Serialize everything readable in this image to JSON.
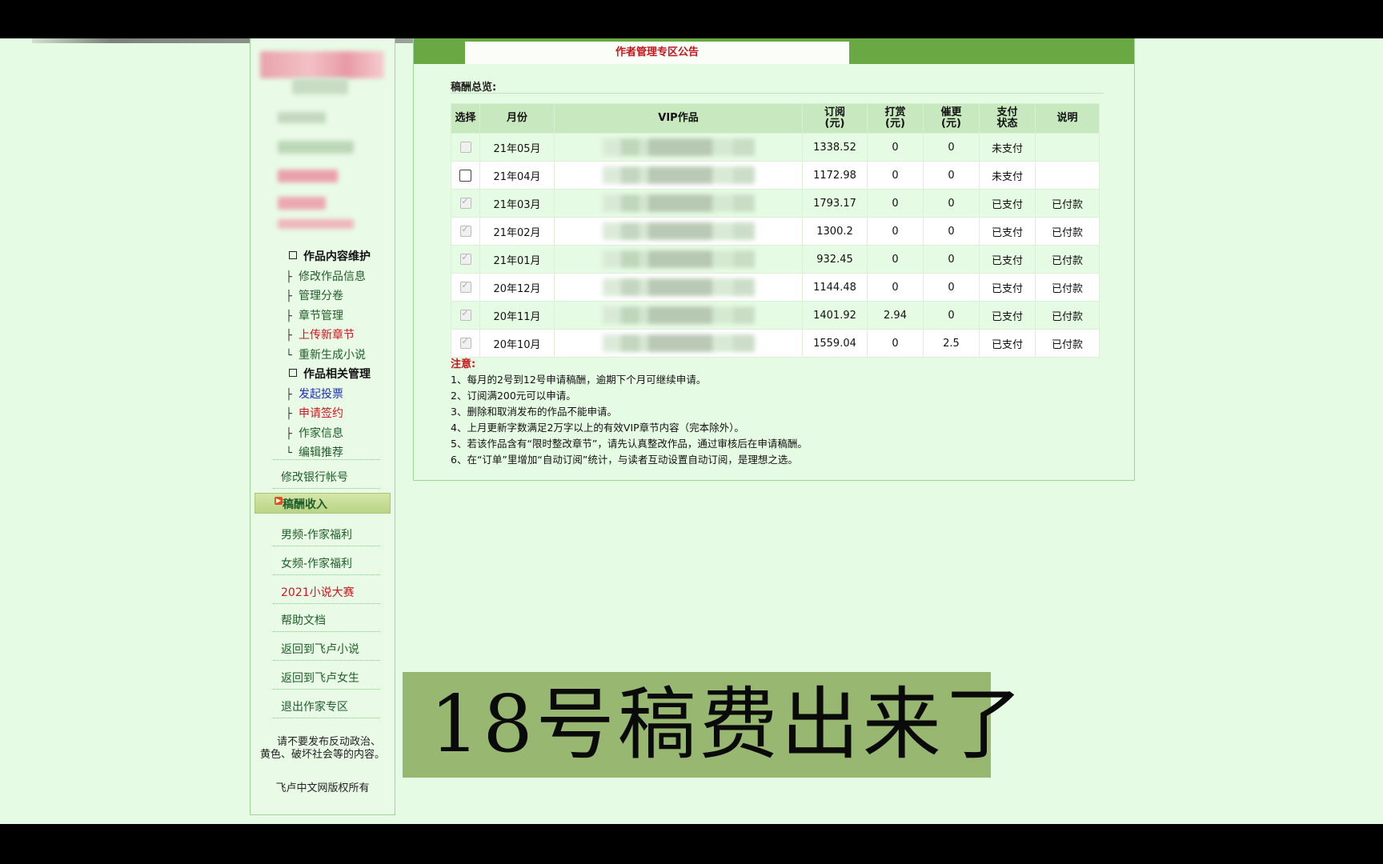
{
  "announcement": {
    "title": "作者管理专区公告"
  },
  "sidebar": {
    "tree": [
      {
        "type": "head",
        "label": "作品内容维护"
      },
      {
        "type": "item",
        "prefix": "├",
        "label": "修改作品信息",
        "color": "#1f5d2a"
      },
      {
        "type": "item",
        "prefix": "├",
        "label": "管理分卷",
        "color": "#1f5d2a"
      },
      {
        "type": "item",
        "prefix": "├",
        "label": "章节管理",
        "color": "#1f5d2a"
      },
      {
        "type": "item",
        "prefix": "├",
        "label": "上传新章节",
        "color": "#d2141f"
      },
      {
        "type": "item",
        "prefix": "└",
        "label": "重新生成小说",
        "color": "#1f5d2a"
      },
      {
        "type": "head",
        "label": "作品相关管理"
      },
      {
        "type": "item",
        "prefix": "├",
        "label": "发起投票",
        "color": "#1a2fb8"
      },
      {
        "type": "item",
        "prefix": "├",
        "label": "申请签约",
        "color": "#d2141f"
      },
      {
        "type": "item",
        "prefix": "├",
        "label": "作家信息",
        "color": "#1f5d2a"
      },
      {
        "type": "item",
        "prefix": "└",
        "label": "编辑推荐",
        "color": "#1f5d2a"
      }
    ],
    "bank_link": "修改银行帐号",
    "active": "稿酬收入",
    "links": [
      {
        "label": "男频-作家福利",
        "color": "#1f5d2a"
      },
      {
        "label": "女频-作家福利",
        "color": "#1f5d2a"
      },
      {
        "label": "2021小说大赛",
        "color": "#d2141f"
      },
      {
        "label": "帮助文档",
        "color": "#1f5d2a"
      },
      {
        "label": "返回到飞卢小说",
        "color": "#1f5d2a"
      },
      {
        "label": "返回到飞卢女生",
        "color": "#1f5d2a"
      },
      {
        "label": "退出作家专区",
        "color": "#1f5d2a"
      }
    ],
    "notice_line1": "请不要发布反动政治、",
    "notice_line2": "黄色、破坏社会等的内容。",
    "copyright": "飞卢中文网版权所有"
  },
  "payments": {
    "section_title": "稿酬总览:",
    "headers": {
      "select": "选择",
      "month": "月份",
      "work": "VIP作品",
      "sub_a": "订阅",
      "sub_b": "(元)",
      "tip_a": "打赏",
      "tip_b": "(元)",
      "urge_a": "催更",
      "urge_b": "(元)",
      "pay_a": "支付",
      "pay_b": "状态",
      "note": "说明"
    },
    "rows": [
      {
        "month": "21年05月",
        "subscribe": "1338.52",
        "tip": "0",
        "urge": "0",
        "status": "未支付",
        "note": "",
        "checkbox": "disabled"
      },
      {
        "month": "21年04月",
        "subscribe": "1172.98",
        "tip": "0",
        "urge": "0",
        "status": "未支付",
        "note": "",
        "checkbox": "enabled"
      },
      {
        "month": "21年03月",
        "subscribe": "1793.17",
        "tip": "0",
        "urge": "0",
        "status": "已支付",
        "note": "已付款",
        "checkbox": "checked"
      },
      {
        "month": "21年02月",
        "subscribe": "1300.2",
        "tip": "0",
        "urge": "0",
        "status": "已支付",
        "note": "已付款",
        "checkbox": "checked"
      },
      {
        "month": "21年01月",
        "subscribe": "932.45",
        "tip": "0",
        "urge": "0",
        "status": "已支付",
        "note": "已付款",
        "checkbox": "checked"
      },
      {
        "month": "20年12月",
        "subscribe": "1144.48",
        "tip": "0",
        "urge": "0",
        "status": "已支付",
        "note": "已付款",
        "checkbox": "checked"
      },
      {
        "month": "20年11月",
        "subscribe": "1401.92",
        "tip": "2.94",
        "urge": "0",
        "status": "已支付",
        "note": "已付款",
        "checkbox": "checked"
      },
      {
        "month": "20年10月",
        "subscribe": "1559.04",
        "tip": "0",
        "urge": "2.5",
        "status": "已支付",
        "note": "已付款",
        "checkbox": "checked"
      }
    ]
  },
  "notes": {
    "title": "注意:",
    "items": [
      "1、每月的2号到12号申请稿酬，逾期下个月可继续申请。",
      "2、订阅满200元可以申请。",
      "3、删除和取消发布的作品不能申请。",
      "4、上月更新字数满足2万字以上的有效VIP章节内容（完本除外）。",
      "5、若该作品含有“限时整改章节”，请先认真整改作品，通过审核后在申请稿酬。",
      "6、在“订单”里增加“自动订阅”统计，与读者互动设置自动订阅，是理想之选。"
    ]
  },
  "caption": {
    "text": "18号稿费出来了"
  },
  "colors": {
    "header_green": "#6aa843",
    "page_bg": "#e6fbe3",
    "alert_red": "#c4161c",
    "caption_bg": "#98b872"
  }
}
